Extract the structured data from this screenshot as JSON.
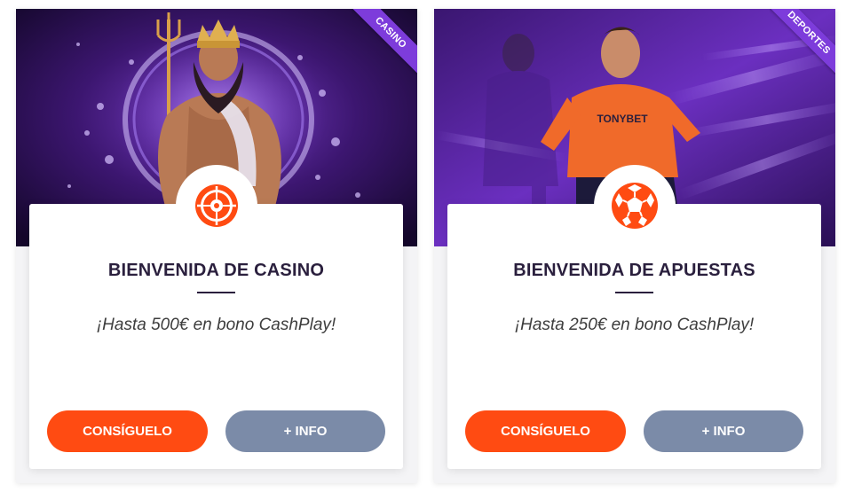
{
  "cards": [
    {
      "ribbon": "CASINO",
      "icon": "roulette-icon",
      "title": "BIENVENIDA DE CASINO",
      "subtitle": "¡Hasta 500€ en bono CashPlay!",
      "primary_button": "CONSÍGUELO",
      "secondary_button": "+ INFO",
      "jersey_text": ""
    },
    {
      "ribbon": "DEPORTES",
      "icon": "soccer-ball-icon",
      "title": "BIENVENIDA DE APUESTAS",
      "subtitle": "¡Hasta 250€ en bono CashPlay!",
      "primary_button": "CONSÍGUELO",
      "secondary_button": "+ INFO",
      "jersey_text": "TONYBET"
    }
  ],
  "colors": {
    "accent_orange": "#ff4b12",
    "secondary_gray": "#7b8ba8",
    "ribbon_purple": "#7d3cdb",
    "title_text": "#2a1f3d"
  }
}
